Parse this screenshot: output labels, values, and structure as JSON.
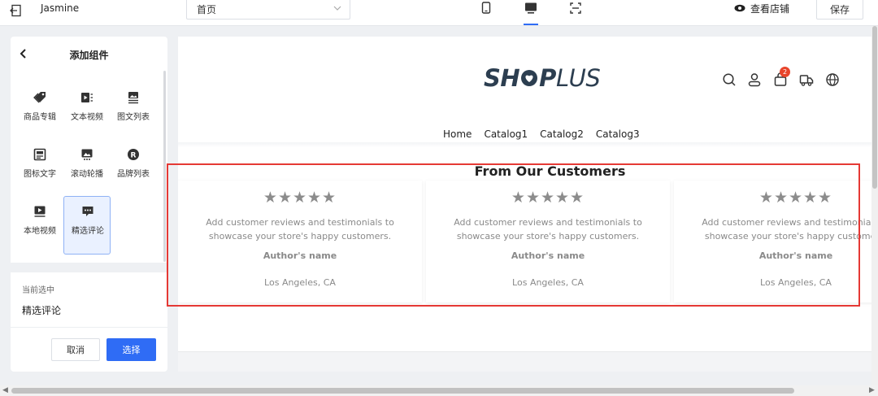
{
  "topbar": {
    "store_name": "Jasmine",
    "page_select_value": "首页",
    "view_store_label": "查看店铺",
    "save_label": "保存",
    "active_device": "desktop"
  },
  "left_panel": {
    "title": "添加组件",
    "components": [
      {
        "label": "商品专辑",
        "icon": "tag-icon"
      },
      {
        "label": "文本视频",
        "icon": "video-text-icon"
      },
      {
        "label": "图文列表",
        "icon": "image-list-icon"
      },
      {
        "label": "图标文字",
        "icon": "icon-text-icon"
      },
      {
        "label": "滚动轮播",
        "icon": "carousel-icon"
      },
      {
        "label": "品牌列表",
        "icon": "brand-icon"
      },
      {
        "label": "本地视频",
        "icon": "local-video-icon"
      },
      {
        "label": "精选评论",
        "icon": "comment-icon",
        "selected": true
      }
    ],
    "current_label": "当前选中",
    "current_value": "精选评论",
    "cancel_label": "取消",
    "select_label": "选择"
  },
  "preview": {
    "logo": {
      "part1": "SH",
      "part2": "P",
      "part3": "LUS"
    },
    "cart_count": "2",
    "nav": [
      "Home",
      "Catalog1",
      "Catalog2",
      "Catalog3"
    ],
    "section_title": "From Our Customers",
    "reviews": [
      {
        "stars": "★★★★★",
        "text": "Add customer reviews and testimonials to showcase your store's happy customers.",
        "author": "Author's name",
        "location": "Los Angeles, CA"
      },
      {
        "stars": "★★★★★",
        "text": "Add customer reviews and testimonials to showcase your store's happy customers.",
        "author": "Author's name",
        "location": "Los Angeles, CA"
      },
      {
        "stars": "★★★★★",
        "text": "Add customer reviews and testimonials to showcase your store's happy customers.",
        "author": "Author's name",
        "location": "Los Angeles, CA"
      }
    ]
  },
  "colors": {
    "accent": "#2f6cf5",
    "highlight": "#e53935",
    "badge": "#e8452c",
    "logo": "#2c3e50"
  }
}
